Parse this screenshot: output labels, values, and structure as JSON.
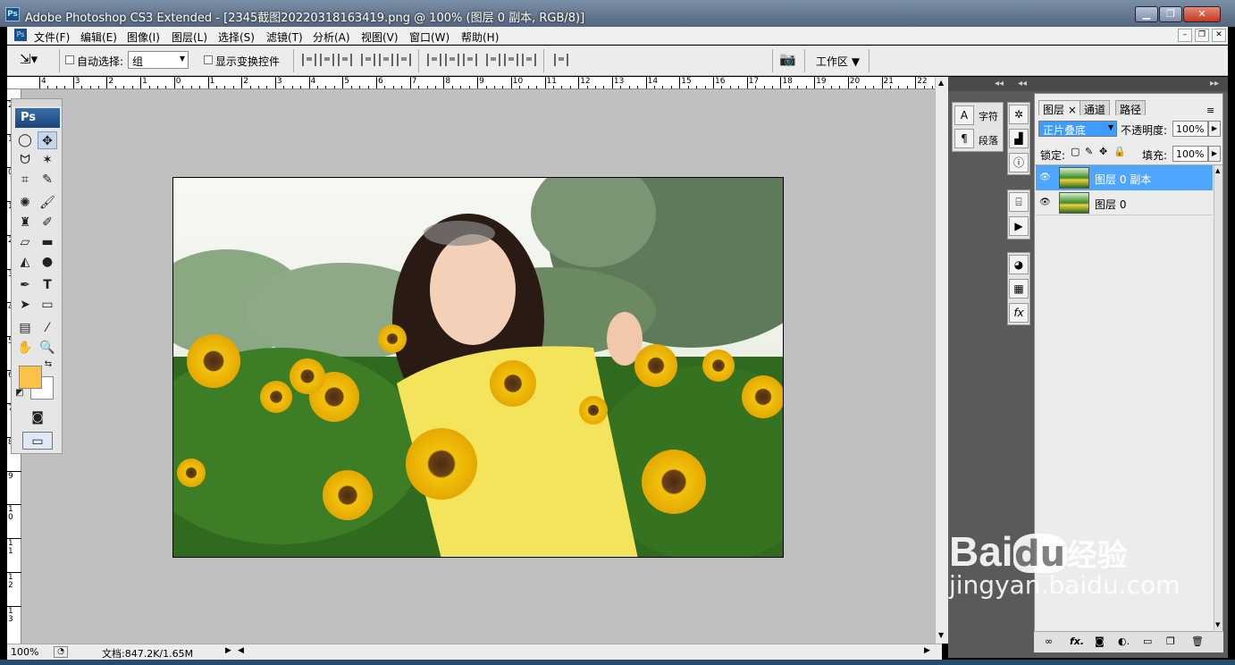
{
  "window": {
    "title": "Adobe Photoshop CS3 Extended - [2345截图20220318163419.png @ 100% (图层 0 副本, RGB/8)]",
    "app_icon": "Ps",
    "controls": [
      "minimize-icon",
      "restore-icon",
      "close-icon"
    ]
  },
  "menu": {
    "items": [
      "文件(F)",
      "编辑(E)",
      "图像(I)",
      "图层(L)",
      "选择(S)",
      "滤镜(T)",
      "分析(A)",
      "视图(V)",
      "窗口(W)",
      "帮助(H)"
    ]
  },
  "options": {
    "auto_select_label": "自动选择:",
    "auto_select_value": "组",
    "show_transform_label": "显示变换控件",
    "workspace_label": "工作区"
  },
  "rulers": {
    "h_labels": [
      "4",
      "3",
      "2",
      "1",
      "0",
      "1",
      "2",
      "3",
      "4",
      "5",
      "6",
      "7",
      "8",
      "9",
      "10",
      "11",
      "12",
      "13",
      "14",
      "15",
      "16",
      "17",
      "18",
      "19",
      "20",
      "21",
      "22"
    ],
    "v_labels": [
      "2",
      "1",
      "0",
      "1",
      "2",
      "3",
      "4",
      "5",
      "6",
      "7",
      "8",
      "9",
      "1\n0",
      "1\n1",
      "1\n2",
      "1\n3"
    ]
  },
  "toolbox": {
    "logo": "Ps",
    "fg_color": "#fbc24a",
    "bg_color": "#ffffff"
  },
  "mini_panel": {
    "char_label": "字符",
    "para_label": "段落"
  },
  "layers_panel": {
    "tabs": [
      "图层",
      "通道",
      "路径"
    ],
    "blend_mode": "正片叠底",
    "opacity_label": "不透明度:",
    "opacity_value": "100%",
    "lock_label": "锁定:",
    "fill_label": "填充:",
    "fill_value": "100%",
    "layers": [
      {
        "name": "图层 0 副本",
        "active": true
      },
      {
        "name": "图层 0",
        "active": false
      }
    ]
  },
  "status": {
    "zoom": "100%",
    "doc_info": "文档:847.2K/1.65M"
  },
  "watermark": {
    "brand": "Bai",
    "brand_du": "du",
    "brand_cn": "经验",
    "url": "jingyan.baidu.com"
  }
}
